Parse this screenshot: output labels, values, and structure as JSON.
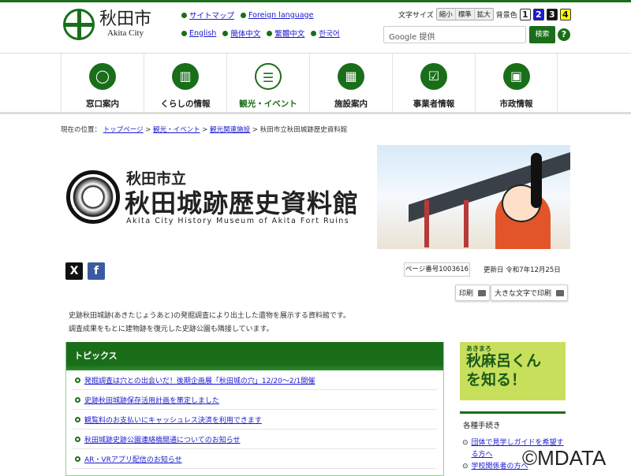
{
  "header": {
    "logo_jp": "秋田市",
    "logo_en": "Akita City",
    "links_row1": [
      "サイトマップ",
      "Foreign language"
    ],
    "links_row2": [
      "English",
      "簡体中文",
      "繁體中文",
      "한국어"
    ],
    "font_size_label": "文字サイズ",
    "font_sizes": [
      "縮小",
      "標準",
      "拡大"
    ],
    "bg_color_label": "背景色",
    "bg_options": [
      "1",
      "2",
      "3",
      "4"
    ],
    "search_placeholder": "Google 提供",
    "search_button": "検索",
    "help": "?"
  },
  "nav": [
    {
      "label": "窓口案内",
      "icon": "person-icon"
    },
    {
      "label": "くらしの情報",
      "icon": "book-icon"
    },
    {
      "label": "観光・イベント",
      "icon": "lantern-icon",
      "active": true
    },
    {
      "label": "施設案内",
      "icon": "building-icon"
    },
    {
      "label": "事業者情報",
      "icon": "document-check-icon"
    },
    {
      "label": "市政情報",
      "icon": "monitor-chart-icon"
    }
  ],
  "breadcrumb": {
    "label": "現在の位置：",
    "links": [
      "トップページ",
      "観光・イベント",
      "観光関連施設"
    ],
    "current": "秋田市立秋田城跡歴史資料館"
  },
  "banner": {
    "line1": "秋田市立",
    "line2": "秋田城跡歴史資料館",
    "line3": "Akita City History Museum of Akita Fort Ruins"
  },
  "social": {
    "x": "X",
    "facebook": "f"
  },
  "page_number": "ページ番号1003616",
  "updated": "更新日 令和7年12月25日",
  "print": "印刷",
  "print_large": "大きな文字で印刷",
  "description": [
    "史跡秋田城跡(あきたじょうあと)の発掘調査により出土した遺物を展示する資料館です。",
    "調査成果をもとに建物跡を復元した史跡公園も隣接しています。"
  ],
  "topics": {
    "title": "トピックス",
    "items": [
      "発掘調査は穴との出会いだ！後期企画展「秋田城の穴」12/20～2/1開催",
      "史跡秋田城跡保存活用計画を策定しました",
      "観覧料のお支払いにキャッシュレス決済を利用できます",
      "秋田城跡史跡公園連絡橋開通についてのお知らせ",
      "AR・VRアプリ配信のお知らせ"
    ]
  },
  "sidebar": {
    "banner_ruby": "あきまろ",
    "banner_line1": "秋麻呂くん",
    "banner_line2": "を知る！",
    "heading": "各種手続き",
    "links": [
      "団体で見学しガイドを希望する方へ",
      "学校関係者の方へ"
    ]
  },
  "watermark": "©MDATA",
  "colors": {
    "brand": "#1a6e1a"
  }
}
